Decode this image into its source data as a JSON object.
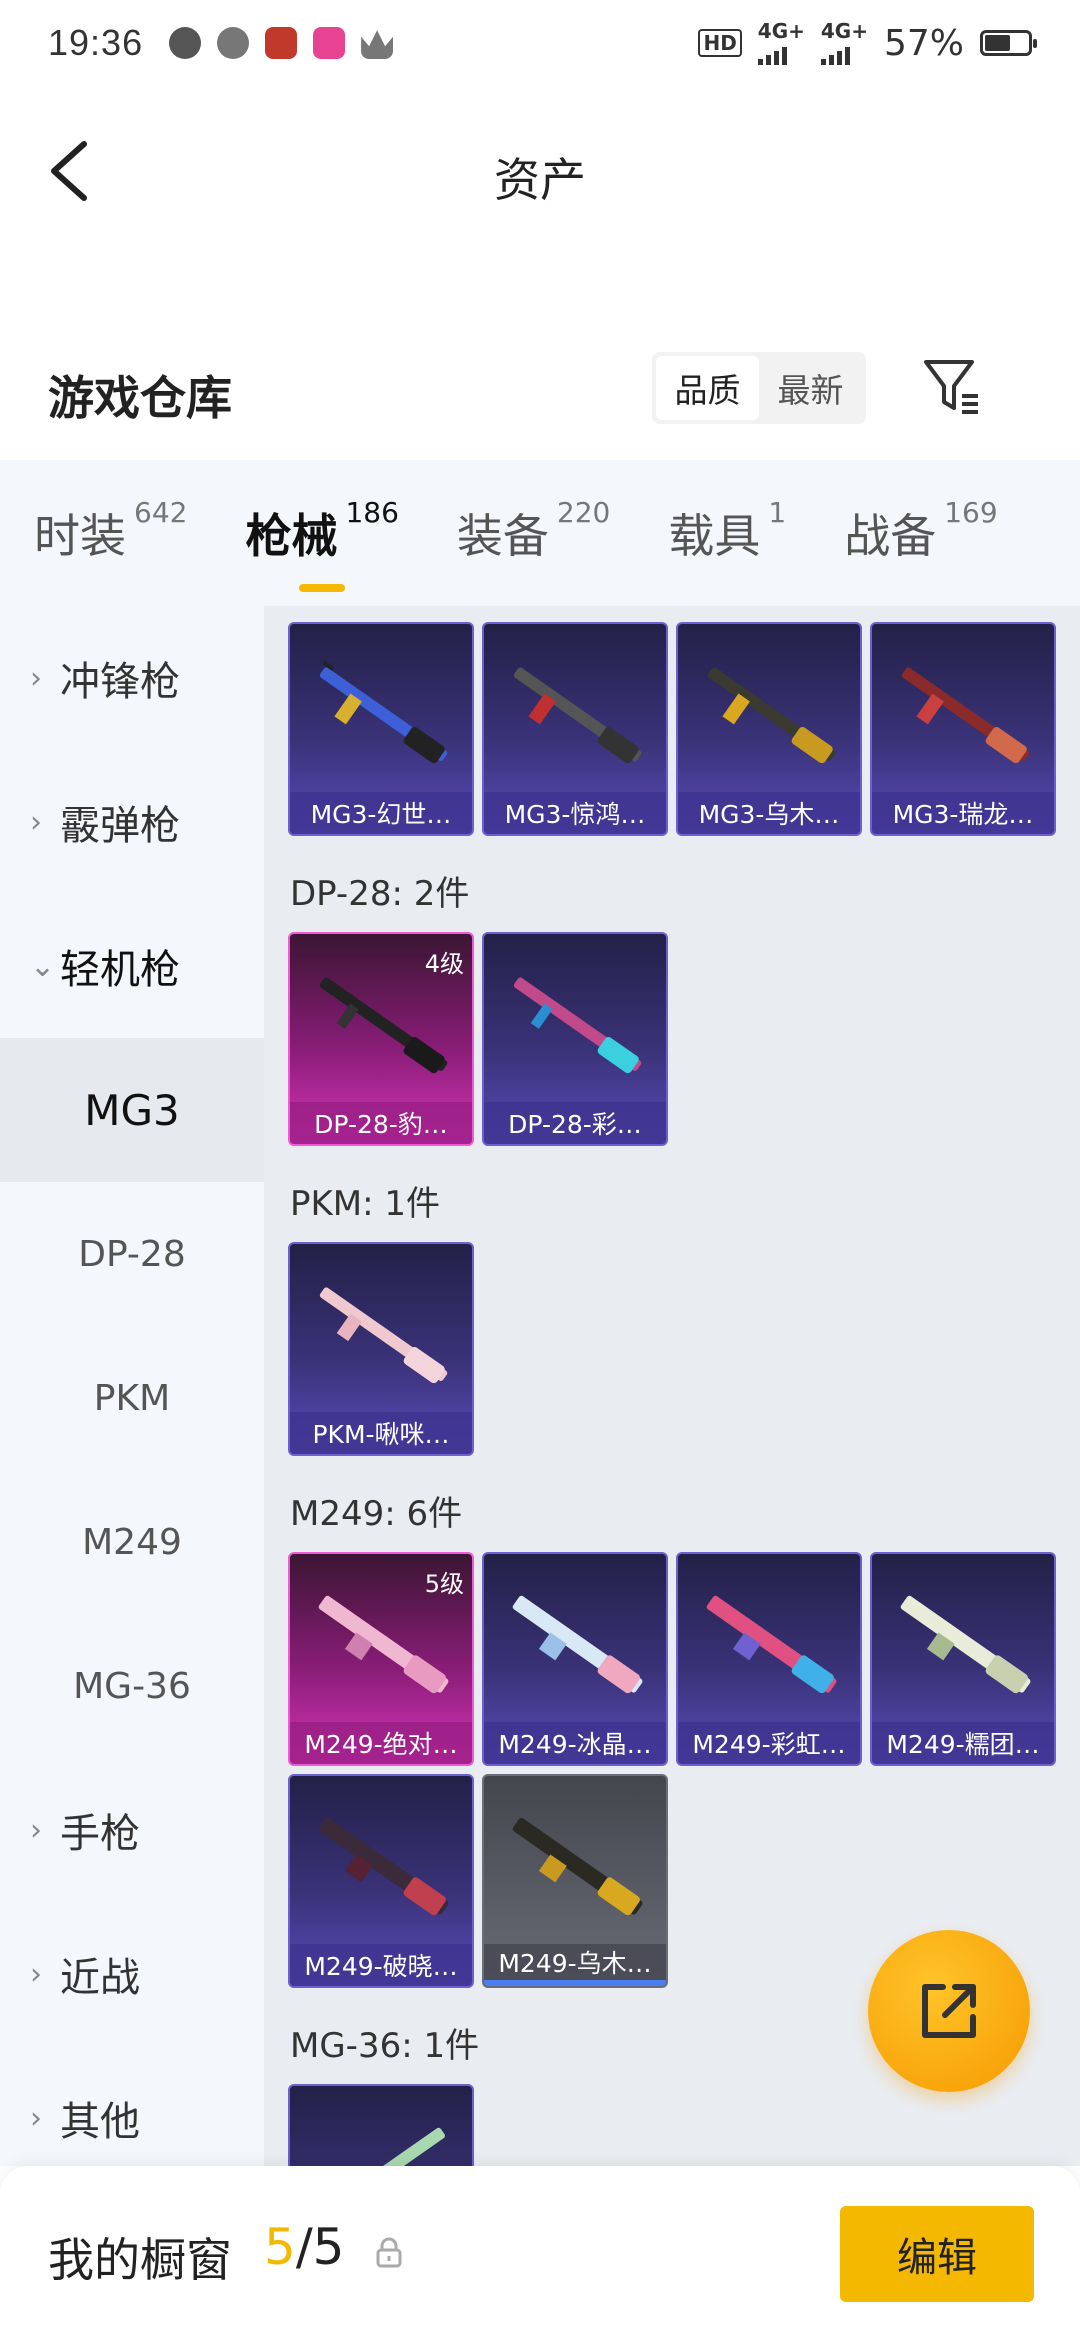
{
  "status_bar": {
    "time": "19:36",
    "network_1": "4G+",
    "network_2": "4G+",
    "hd_label": "HD",
    "battery": "57%"
  },
  "header": {
    "title": "资产"
  },
  "warehouse": {
    "title": "游戏仓库",
    "sort_quality": "品质",
    "sort_newest": "最新"
  },
  "tabs": [
    {
      "label": "时装",
      "count": "642"
    },
    {
      "label": "枪械",
      "count": "186"
    },
    {
      "label": "装备",
      "count": "220"
    },
    {
      "label": "载具",
      "count": "1"
    },
    {
      "label": "战备",
      "count": "169"
    }
  ],
  "sidebar": {
    "items": [
      {
        "label": "冲锋枪"
      },
      {
        "label": "霰弹枪"
      },
      {
        "label": "轻机枪"
      },
      {
        "label": "MG3"
      },
      {
        "label": "DP-28"
      },
      {
        "label": "PKM"
      },
      {
        "label": "M249"
      },
      {
        "label": "MG-36"
      },
      {
        "label": "手枪"
      },
      {
        "label": "近战"
      },
      {
        "label": "其他"
      }
    ]
  },
  "sections": {
    "dp28": "DP-28: 2件",
    "pkm": "PKM: 1件",
    "m249": "M249: 6件",
    "mg36": "MG-36: 1件"
  },
  "items": {
    "mg3": [
      {
        "name": "MG3-幻世…"
      },
      {
        "name": "MG3-惊鸿…"
      },
      {
        "name": "MG3-乌木…"
      },
      {
        "name": "MG3-瑞龙…"
      }
    ],
    "dp28": [
      {
        "name": "DP-28-豹…",
        "level": "4级"
      },
      {
        "name": "DP-28-彩…"
      }
    ],
    "pkm": [
      {
        "name": "PKM-啾咪…"
      }
    ],
    "m249": [
      {
        "name": "M249-绝对…",
        "level": "5级"
      },
      {
        "name": "M249-冰晶…"
      },
      {
        "name": "M249-彩虹…"
      },
      {
        "name": "M249-糯团…"
      },
      {
        "name": "M249-破晓…"
      },
      {
        "name": "M249-乌木…"
      }
    ]
  },
  "bottom_bar": {
    "label": "我的橱窗",
    "count_current": "5",
    "count_total": "/5",
    "edit_label": "编辑"
  }
}
